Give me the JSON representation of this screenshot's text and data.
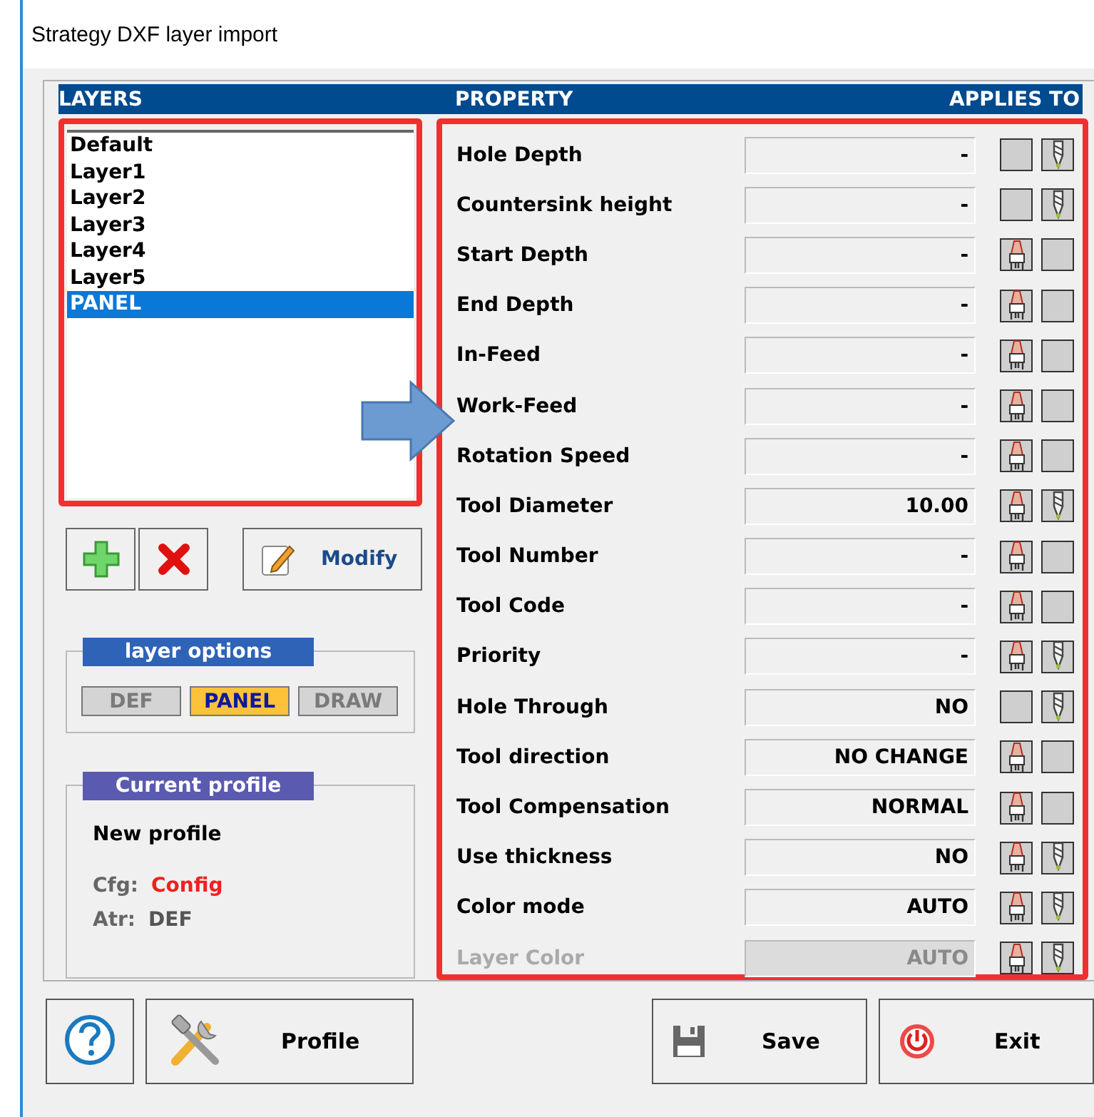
{
  "window": {
    "title": "Strategy DXF layer import"
  },
  "headers": {
    "layers": "LAYERS",
    "property": "PROPERTY",
    "applies_to": "APPLIES TO"
  },
  "layers": [
    {
      "name": "Default",
      "selected": false
    },
    {
      "name": "Layer1",
      "selected": false
    },
    {
      "name": "Layer2",
      "selected": false
    },
    {
      "name": "Layer3",
      "selected": false
    },
    {
      "name": "Layer4",
      "selected": false
    },
    {
      "name": "Layer5",
      "selected": false
    },
    {
      "name": "PANEL",
      "selected": true
    }
  ],
  "layer_buttons": {
    "modify": "Modify"
  },
  "layer_options": {
    "title": "layer options",
    "options": [
      {
        "label": "DEF",
        "selected": false
      },
      {
        "label": "PANEL",
        "selected": true
      },
      {
        "label": "DRAW",
        "selected": false
      }
    ]
  },
  "current_profile": {
    "title": "Current profile",
    "name": "New profile",
    "cfg_label": "Cfg:",
    "cfg_value": "Config",
    "atr_label": "Atr:",
    "atr_value": "DEF"
  },
  "properties": [
    {
      "label": "Hole Depth",
      "value": "-",
      "disabled": false,
      "applies_to": [
        {
          "kind": "panel",
          "on": false
        },
        {
          "kind": "drill",
          "on": true
        }
      ]
    },
    {
      "label": "Countersink height",
      "value": "-",
      "disabled": false,
      "applies_to": [
        {
          "kind": "panel",
          "on": false
        },
        {
          "kind": "drill",
          "on": true
        }
      ]
    },
    {
      "label": "Start Depth",
      "value": "-",
      "disabled": false,
      "applies_to": [
        {
          "kind": "panel",
          "on": true
        },
        {
          "kind": "drill",
          "on": false
        }
      ]
    },
    {
      "label": "End Depth",
      "value": "-",
      "disabled": false,
      "applies_to": [
        {
          "kind": "panel",
          "on": true
        },
        {
          "kind": "drill",
          "on": false
        }
      ]
    },
    {
      "label": "In-Feed",
      "value": "-",
      "disabled": false,
      "applies_to": [
        {
          "kind": "panel",
          "on": true
        },
        {
          "kind": "drill",
          "on": false
        }
      ]
    },
    {
      "label": "Work-Feed",
      "value": "-",
      "disabled": false,
      "applies_to": [
        {
          "kind": "panel",
          "on": true
        },
        {
          "kind": "drill",
          "on": false
        }
      ]
    },
    {
      "label": "Rotation Speed",
      "value": "-",
      "disabled": false,
      "applies_to": [
        {
          "kind": "panel",
          "on": true
        },
        {
          "kind": "drill",
          "on": false
        }
      ]
    },
    {
      "label": "Tool Diameter",
      "value": "10.00",
      "disabled": false,
      "applies_to": [
        {
          "kind": "panel",
          "on": true
        },
        {
          "kind": "drill",
          "on": true
        }
      ]
    },
    {
      "label": "Tool Number",
      "value": "-",
      "disabled": false,
      "applies_to": [
        {
          "kind": "panel",
          "on": true
        },
        {
          "kind": "drill",
          "on": false
        }
      ]
    },
    {
      "label": "Tool Code",
      "value": "-",
      "disabled": false,
      "applies_to": [
        {
          "kind": "panel",
          "on": true
        },
        {
          "kind": "drill",
          "on": false
        }
      ]
    },
    {
      "label": "Priority",
      "value": "-",
      "disabled": false,
      "applies_to": [
        {
          "kind": "panel",
          "on": true
        },
        {
          "kind": "drill",
          "on": true
        }
      ]
    },
    {
      "label": "Hole Through",
      "value": "NO",
      "disabled": false,
      "applies_to": [
        {
          "kind": "panel",
          "on": false
        },
        {
          "kind": "drill",
          "on": true
        }
      ]
    },
    {
      "label": "Tool direction",
      "value": "NO CHANGE",
      "disabled": false,
      "applies_to": [
        {
          "kind": "panel",
          "on": true
        },
        {
          "kind": "drill",
          "on": false
        }
      ]
    },
    {
      "label": "Tool Compensation",
      "value": "NORMAL",
      "disabled": false,
      "applies_to": [
        {
          "kind": "panel",
          "on": true
        },
        {
          "kind": "drill",
          "on": false
        }
      ]
    },
    {
      "label": "Use thickness",
      "value": "NO",
      "disabled": false,
      "applies_to": [
        {
          "kind": "panel",
          "on": true
        },
        {
          "kind": "drill",
          "on": true
        }
      ]
    },
    {
      "label": "Color mode",
      "value": "AUTO",
      "disabled": false,
      "applies_to": [
        {
          "kind": "panel",
          "on": true
        },
        {
          "kind": "drill",
          "on": true
        }
      ]
    },
    {
      "label": "Layer Color",
      "value": "AUTO",
      "disabled": true,
      "applies_to": [
        {
          "kind": "panel",
          "on": true
        },
        {
          "kind": "drill",
          "on": true
        }
      ]
    }
  ],
  "buttons": {
    "profile": "Profile",
    "save": "Save",
    "exit": "Exit"
  }
}
